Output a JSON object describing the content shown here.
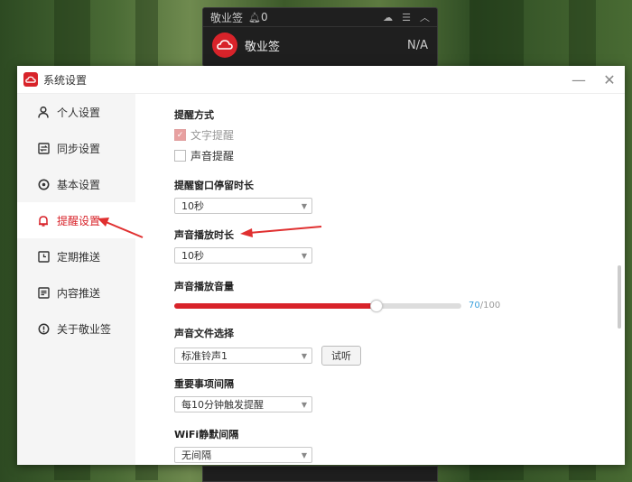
{
  "widget": {
    "title": "敬业签",
    "bell_count": "0",
    "app_name": "敬业签",
    "value": "N/A"
  },
  "window": {
    "title": "系统设置",
    "minimize": "—",
    "close": "✕"
  },
  "sidebar": {
    "items": [
      {
        "label": "个人设置",
        "icon": "person-icon"
      },
      {
        "label": "同步设置",
        "icon": "sync-icon"
      },
      {
        "label": "基本设置",
        "icon": "settings-icon"
      },
      {
        "label": "提醒设置",
        "icon": "bell-icon",
        "active": true
      },
      {
        "label": "定期推送",
        "icon": "clock-icon"
      },
      {
        "label": "内容推送",
        "icon": "content-icon"
      },
      {
        "label": "关于敬业签",
        "icon": "info-icon"
      }
    ]
  },
  "content": {
    "remind_method": {
      "title": "提醒方式",
      "text_remind": "文字提醒",
      "text_remind_checked": true,
      "sound_remind": "声音提醒",
      "sound_remind_checked": false
    },
    "window_duration": {
      "title": "提醒窗口停留时长",
      "value": "10秒"
    },
    "sound_duration": {
      "title": "声音播放时长",
      "value": "10秒"
    },
    "volume": {
      "title": "声音播放音量",
      "value": 70,
      "value_text": "70",
      "max_text": "/100"
    },
    "sound_file": {
      "title": "声音文件选择",
      "value": "标准铃声1",
      "button": "试听"
    },
    "important_interval": {
      "title": "重要事项间隔",
      "value": "每10分钟触发提醒"
    },
    "wifi_silence": {
      "title": "WiFi静默间隔",
      "value": "无间隔"
    }
  },
  "colors": {
    "accent": "#d8232a",
    "volume_value": "#3aa0dc",
    "annotation_arrow": "#e03030"
  }
}
